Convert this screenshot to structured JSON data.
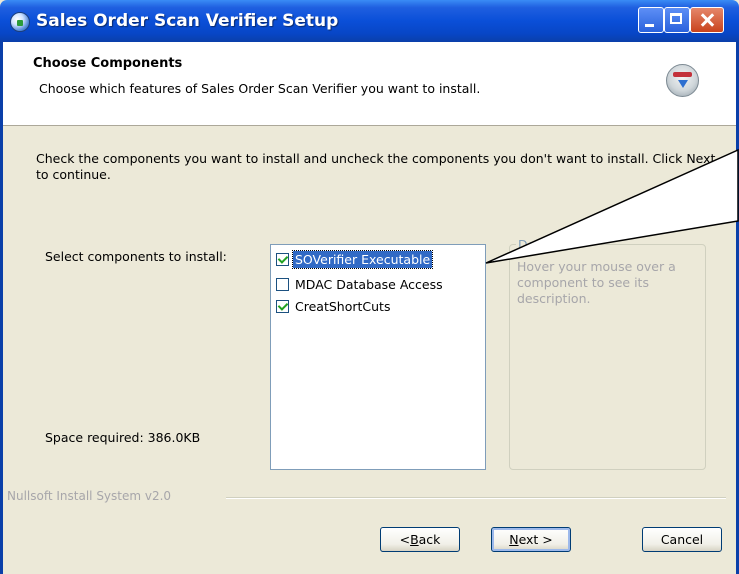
{
  "window": {
    "title": "Sales Order Scan Verifier Setup"
  },
  "header": {
    "title": "Choose Components",
    "subtitle": "Choose which features of Sales Order Scan Verifier you want to install.",
    "icon": "installer-disc-icon"
  },
  "body": {
    "intro": "Check the components you want to install and uncheck the components you don't want to install. Click Next to continue.",
    "select_label": "Select components to install:",
    "space_required": "Space required: 386.0KB"
  },
  "components": [
    {
      "label": "SOVerifier Executable",
      "checked": true,
      "selected": true
    },
    {
      "label": "MDAC Database Access",
      "checked": false,
      "selected": false
    },
    {
      "label": "CreatShortCuts",
      "checked": true,
      "selected": false
    }
  ],
  "description": {
    "title": "Desc",
    "text": "Hover your mouse over a component to see its description."
  },
  "branding": "Nullsoft Install System v2.0",
  "buttons": {
    "back": {
      "prefix": "< ",
      "mnemonic": "B",
      "rest": "ack"
    },
    "next": {
      "mnemonic": "N",
      "rest": "ext >"
    },
    "cancel": "Cancel"
  },
  "colors": {
    "titlebar": "#0A4FD8",
    "dialog_bg": "#ECE9D8",
    "selection": "#316AC5",
    "checkmark": "#21A121"
  }
}
